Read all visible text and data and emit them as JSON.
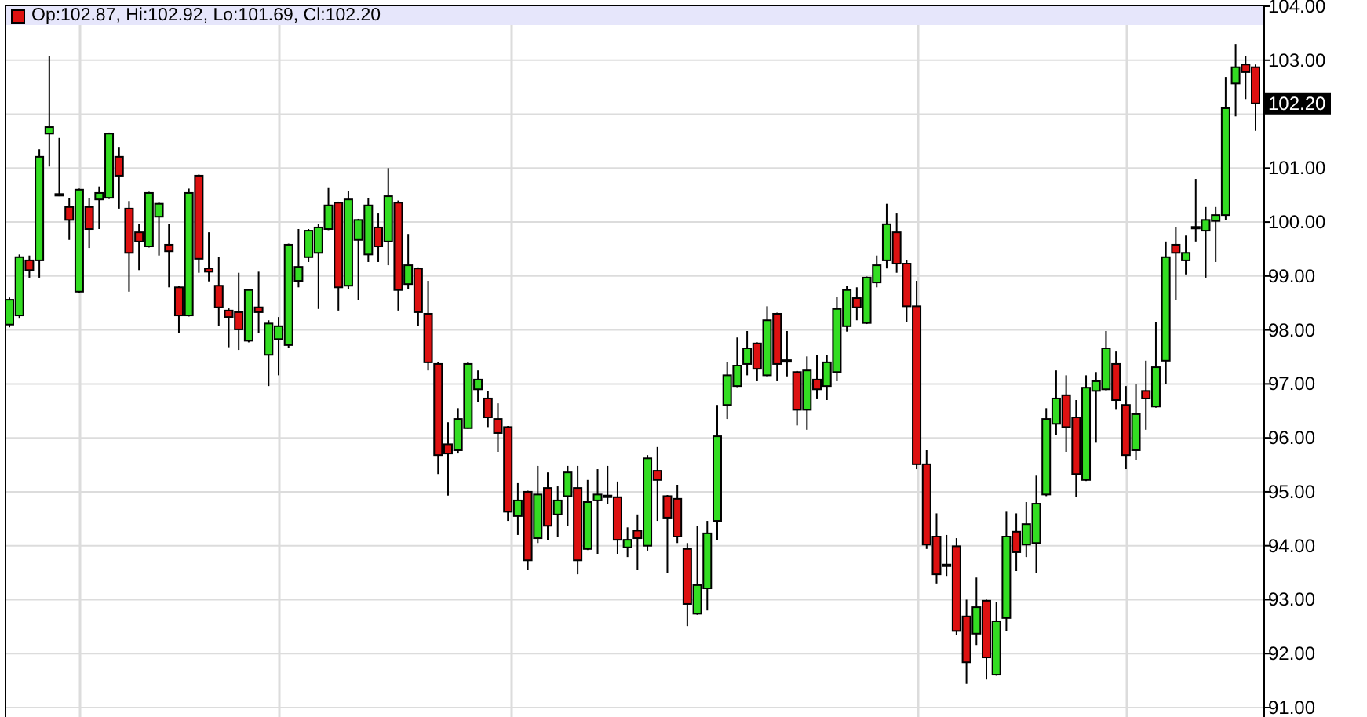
{
  "chart": {
    "readout": "Op:102.87, Hi:102.92, Lo:101.69, Cl:102.20",
    "last_price": "102.20",
    "chart_data": {
      "type": "candlestick",
      "grid": true,
      "ylim": [
        91,
        104
      ],
      "yticks": [
        {
          "value": 91,
          "label": "91.00"
        },
        {
          "value": 92,
          "label": "92.00"
        },
        {
          "value": 93,
          "label": "93.00"
        },
        {
          "value": 94,
          "label": "94.00"
        },
        {
          "value": 95,
          "label": "95.00"
        },
        {
          "value": 96,
          "label": "96.00"
        },
        {
          "value": 97,
          "label": "97.00"
        },
        {
          "value": 98,
          "label": "98.00"
        },
        {
          "value": 99,
          "label": "99.00"
        },
        {
          "value": 100,
          "label": "100.00"
        },
        {
          "value": 101,
          "label": "101.00"
        },
        {
          "value": 103,
          "label": "103.00"
        },
        {
          "value": 104,
          "label": "104.00"
        }
      ],
      "ohlc": [
        [
          98.1,
          98.6,
          98.05,
          98.56
        ],
        [
          98.27,
          99.4,
          98.21,
          99.35
        ],
        [
          99.29,
          99.38,
          98.97,
          99.11
        ],
        [
          99.29,
          101.35,
          98.97,
          101.21
        ],
        [
          101.64,
          103.07,
          101.03,
          101.76
        ],
        [
          100.52,
          101.56,
          100.48,
          100.5
        ],
        [
          100.28,
          100.45,
          99.67,
          100.04
        ],
        [
          98.71,
          100.62,
          98.69,
          100.6
        ],
        [
          100.28,
          100.45,
          99.52,
          99.87
        ],
        [
          100.42,
          100.66,
          99.87,
          100.54
        ],
        [
          100.45,
          101.66,
          100.43,
          101.64
        ],
        [
          101.21,
          101.38,
          100.25,
          100.86
        ],
        [
          100.25,
          100.39,
          98.71,
          99.43
        ],
        [
          99.81,
          99.96,
          99.11,
          99.64
        ],
        [
          99.55,
          100.56,
          99.53,
          100.54
        ],
        [
          100.1,
          100.36,
          99.38,
          100.34
        ],
        [
          99.58,
          99.96,
          98.79,
          99.46
        ],
        [
          98.79,
          98.81,
          97.95,
          98.27
        ],
        [
          98.27,
          100.62,
          98.25,
          100.54
        ],
        [
          100.86,
          100.88,
          99.06,
          99.32
        ],
        [
          99.14,
          99.81,
          98.9,
          99.08
        ],
        [
          98.82,
          99.35,
          98.07,
          98.42
        ],
        [
          98.36,
          98.4,
          97.68,
          98.24
        ],
        [
          98.33,
          99.06,
          97.63,
          98.01
        ],
        [
          97.8,
          98.76,
          97.77,
          98.74
        ],
        [
          98.42,
          99.08,
          97.95,
          98.33
        ],
        [
          97.54,
          98.18,
          96.96,
          98.12
        ],
        [
          97.83,
          98.24,
          97.16,
          98.07
        ],
        [
          97.72,
          99.6,
          97.66,
          99.58
        ],
        [
          98.91,
          99.87,
          98.79,
          99.17
        ],
        [
          99.35,
          99.87,
          99.26,
          99.84
        ],
        [
          99.43,
          99.96,
          98.39,
          99.9
        ],
        [
          99.87,
          100.63,
          99.85,
          100.31
        ],
        [
          100.36,
          100.38,
          98.36,
          98.79
        ],
        [
          98.82,
          100.57,
          98.76,
          100.42
        ],
        [
          99.67,
          100.06,
          98.56,
          100.04
        ],
        [
          99.4,
          100.45,
          99.26,
          100.31
        ],
        [
          99.9,
          100.16,
          99.26,
          99.55
        ],
        [
          99.64,
          101.0,
          99.2,
          100.48
        ],
        [
          100.36,
          100.4,
          98.36,
          98.74
        ],
        [
          98.85,
          99.78,
          98.76,
          99.2
        ],
        [
          99.14,
          99.16,
          98.07,
          98.33
        ],
        [
          98.3,
          98.91,
          97.25,
          97.4
        ],
        [
          97.37,
          97.4,
          95.33,
          95.68
        ],
        [
          95.88,
          96.29,
          94.93,
          95.71
        ],
        [
          95.77,
          96.55,
          95.71,
          96.35
        ],
        [
          96.18,
          97.4,
          96.17,
          97.37
        ],
        [
          96.9,
          97.25,
          96.67,
          97.08
        ],
        [
          96.73,
          96.87,
          96.2,
          96.38
        ],
        [
          96.35,
          96.64,
          95.74,
          96.09
        ],
        [
          96.2,
          96.22,
          94.46,
          94.63
        ],
        [
          94.55,
          95.16,
          94.2,
          94.84
        ],
        [
          95.0,
          95.02,
          93.55,
          93.73
        ],
        [
          94.14,
          95.48,
          94.05,
          94.95
        ],
        [
          95.07,
          95.36,
          94.11,
          94.37
        ],
        [
          94.58,
          95.1,
          94.17,
          94.84
        ],
        [
          94.92,
          95.48,
          94.37,
          95.36
        ],
        [
          95.07,
          95.48,
          93.47,
          93.73
        ],
        [
          93.94,
          95.22,
          93.92,
          94.81
        ],
        [
          94.84,
          95.42,
          93.85,
          94.95
        ],
        [
          94.93,
          95.48,
          94.78,
          94.92
        ],
        [
          94.9,
          95.19,
          93.85,
          94.11
        ],
        [
          93.97,
          94.34,
          93.79,
          94.11
        ],
        [
          94.28,
          94.58,
          93.55,
          94.14
        ],
        [
          94.0,
          95.68,
          93.91,
          95.62
        ],
        [
          95.39,
          95.83,
          94.46,
          95.22
        ],
        [
          94.92,
          94.94,
          93.5,
          94.52
        ],
        [
          94.87,
          95.13,
          94.05,
          94.17
        ],
        [
          93.94,
          94.05,
          92.51,
          92.92
        ],
        [
          92.74,
          94.37,
          92.72,
          93.27
        ],
        [
          93.21,
          94.46,
          92.8,
          94.23
        ],
        [
          94.46,
          96.61,
          94.11,
          96.03
        ],
        [
          96.61,
          97.4,
          96.35,
          97.16
        ],
        [
          96.96,
          97.86,
          96.94,
          97.34
        ],
        [
          97.37,
          97.98,
          97.16,
          97.66
        ],
        [
          97.75,
          97.77,
          97.05,
          97.28
        ],
        [
          97.16,
          98.44,
          97.14,
          98.18
        ],
        [
          98.3,
          98.32,
          97.05,
          97.37
        ],
        [
          97.44,
          97.98,
          97.14,
          97.43
        ],
        [
          97.22,
          97.24,
          96.23,
          96.52
        ],
        [
          96.52,
          97.51,
          96.15,
          97.25
        ],
        [
          97.08,
          97.54,
          96.73,
          96.9
        ],
        [
          96.96,
          97.54,
          96.7,
          97.4
        ],
        [
          97.22,
          98.62,
          97.05,
          98.39
        ],
        [
          98.07,
          98.82,
          97.97,
          98.74
        ],
        [
          98.59,
          98.79,
          98.18,
          98.42
        ],
        [
          98.13,
          98.99,
          98.11,
          98.97
        ],
        [
          98.88,
          99.38,
          98.79,
          99.2
        ],
        [
          99.29,
          100.34,
          99.14,
          99.96
        ],
        [
          99.81,
          100.16,
          99.06,
          99.23
        ],
        [
          99.23,
          99.29,
          98.15,
          98.44
        ],
        [
          98.44,
          98.91,
          95.42,
          95.51
        ],
        [
          95.51,
          95.77,
          93.94,
          94.02
        ],
        [
          94.17,
          94.6,
          93.3,
          93.47
        ],
        [
          93.65,
          94.2,
          93.44,
          93.64
        ],
        [
          93.99,
          94.14,
          92.34,
          92.42
        ],
        [
          92.69,
          93.0,
          91.44,
          91.84
        ],
        [
          92.37,
          93.41,
          92.16,
          92.86
        ],
        [
          92.98,
          93.0,
          91.52,
          91.93
        ],
        [
          91.61,
          92.95,
          91.59,
          92.6
        ],
        [
          92.66,
          94.63,
          92.42,
          94.17
        ],
        [
          94.26,
          94.6,
          93.53,
          93.88
        ],
        [
          94.02,
          94.81,
          93.79,
          94.4
        ],
        [
          94.05,
          95.3,
          93.5,
          94.78
        ],
        [
          94.95,
          96.55,
          94.92,
          96.35
        ],
        [
          96.26,
          97.25,
          96.06,
          96.73
        ],
        [
          96.79,
          97.16,
          95.74,
          96.2
        ],
        [
          96.38,
          96.7,
          94.9,
          95.33
        ],
        [
          95.22,
          97.16,
          95.2,
          96.93
        ],
        [
          96.87,
          97.22,
          95.91,
          97.05
        ],
        [
          96.9,
          97.98,
          96.88,
          97.66
        ],
        [
          97.37,
          97.6,
          96.52,
          96.7
        ],
        [
          96.61,
          96.96,
          95.42,
          95.68
        ],
        [
          95.77,
          96.99,
          95.59,
          96.44
        ],
        [
          96.87,
          97.43,
          96.15,
          96.73
        ],
        [
          96.58,
          98.15,
          96.56,
          97.31
        ],
        [
          97.43,
          99.64,
          97.0,
          99.35
        ],
        [
          99.58,
          99.9,
          98.56,
          99.43
        ],
        [
          99.29,
          99.75,
          99.03,
          99.43
        ],
        [
          99.91,
          100.8,
          99.64,
          99.9
        ],
        [
          99.84,
          100.28,
          98.97,
          100.04
        ],
        [
          100.02,
          100.28,
          99.26,
          100.13
        ],
        [
          100.13,
          102.69,
          100.04,
          102.11
        ],
        [
          102.57,
          103.3,
          101.96,
          102.87
        ],
        [
          102.92,
          103.07,
          102.28,
          102.78
        ],
        [
          102.87,
          102.92,
          101.69,
          102.2
        ]
      ]
    }
  }
}
